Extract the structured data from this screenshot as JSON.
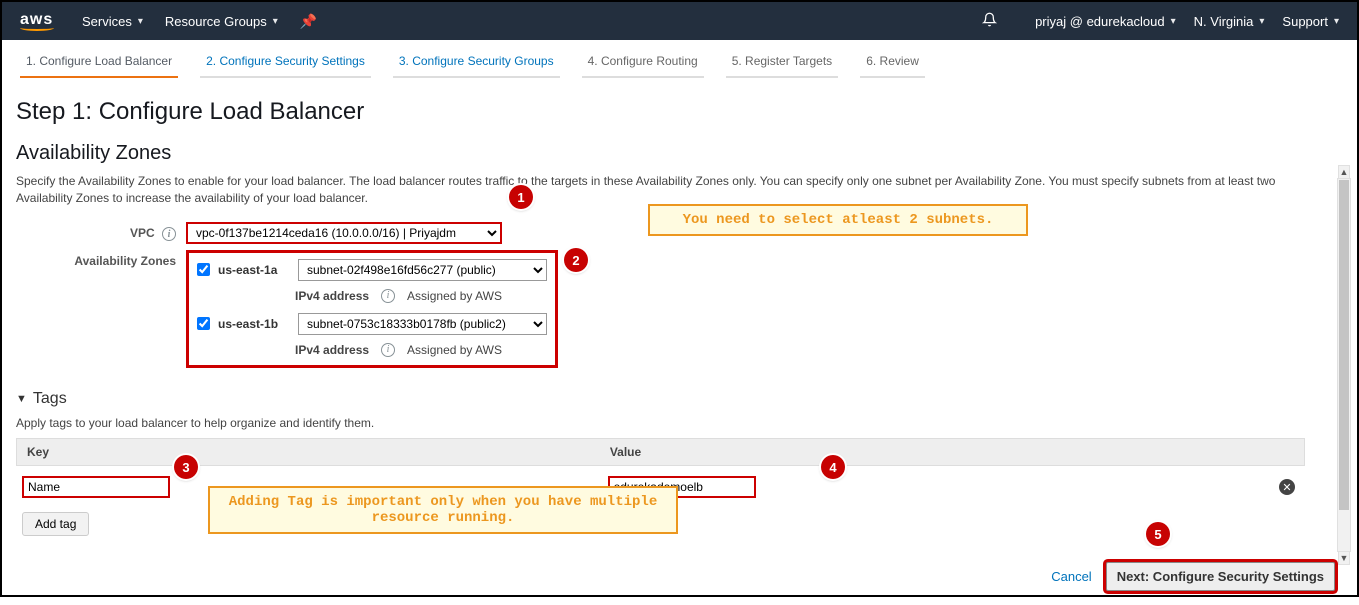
{
  "nav": {
    "logo": "aws",
    "services": "Services",
    "resource_groups": "Resource Groups",
    "user": "priyaj @ edurekacloud",
    "region": "N. Virginia",
    "support": "Support"
  },
  "wizard": {
    "steps": [
      "1. Configure Load Balancer",
      "2. Configure Security Settings",
      "3. Configure Security Groups",
      "4. Configure Routing",
      "5. Register Targets",
      "6. Review"
    ]
  },
  "page_title": "Step 1: Configure Load Balancer",
  "az_section": {
    "title": "Availability Zones",
    "desc": "Specify the Availability Zones to enable for your load balancer. The load balancer routes traffic to the targets in these Availability Zones only. You can specify only one subnet per Availability Zone. You must specify subnets from at least two Availability Zones to increase the availability of your load balancer.",
    "vpc_label": "VPC",
    "vpc_value": "vpc-0f137be1214ceda16 (10.0.0.0/16) | Priyajdm",
    "az_label": "Availability Zones",
    "zones": [
      {
        "name": "us-east-1a",
        "subnet": "subnet-02f498e16fd56c277 (public)",
        "ipv4_label": "IPv4 address",
        "ipv4_value": "Assigned by AWS"
      },
      {
        "name": "us-east-1b",
        "subnet": "subnet-0753c18333b0178fb (public2)",
        "ipv4_label": "IPv4 address",
        "ipv4_value": "Assigned by AWS"
      }
    ],
    "note": "You need to select atleast 2 subnets."
  },
  "tags": {
    "header": "Tags",
    "desc": "Apply tags to your load balancer to help organize and identify them.",
    "columns": {
      "key": "Key",
      "value": "Value"
    },
    "rows": [
      {
        "key": "Name",
        "value": "edurekademoelb"
      }
    ],
    "add_btn": "Add tag",
    "note": "Adding Tag is important only when you have multiple resource running."
  },
  "footer": {
    "cancel": "Cancel",
    "next": "Next: Configure Security Settings"
  },
  "callouts": {
    "c1": "1",
    "c2": "2",
    "c3": "3",
    "c4": "4",
    "c5": "5"
  }
}
